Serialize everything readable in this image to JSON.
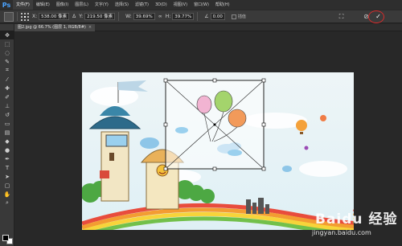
{
  "app": {
    "logo": "Ps"
  },
  "menu": [
    "文件(F)",
    "编辑(E)",
    "图像(I)",
    "图层(L)",
    "文字(Y)",
    "选择(S)",
    "滤镜(T)",
    "3D(D)",
    "视图(V)",
    "窗口(W)",
    "帮助(H)"
  ],
  "options": {
    "x_label": "X:",
    "x_value": "538.00 像素",
    "y_label": "Y:",
    "y_value": "219.50 像素",
    "w_label": "W:",
    "w_value": "39.69%",
    "h_label": "H:",
    "h_value": "39.77%",
    "angle_value": "0.00",
    "interp_label": "插值",
    "cancel_icon": "cancel-transform-icon",
    "commit_icon": "commit-transform-icon",
    "highlight_color": "#d92b2b"
  },
  "document": {
    "tab_title": "图2.jpg @ 66.7% (图层 1, RGB/8#)",
    "close_glyph": "×"
  },
  "tools": [
    "move-icon",
    "marquee-icon",
    "lasso-icon",
    "quick-select-icon",
    "crop-icon",
    "eyedropper-icon",
    "healing-icon",
    "brush-icon",
    "clone-stamp-icon",
    "history-brush-icon",
    "eraser-icon",
    "gradient-icon",
    "blur-icon",
    "dodge-icon",
    "pen-icon",
    "type-icon",
    "path-select-icon",
    "shape-icon",
    "hand-icon",
    "zoom-icon"
  ],
  "watermark": {
    "logo_text": "Baidu 经验",
    "url": "jingyan.baidu.com"
  }
}
